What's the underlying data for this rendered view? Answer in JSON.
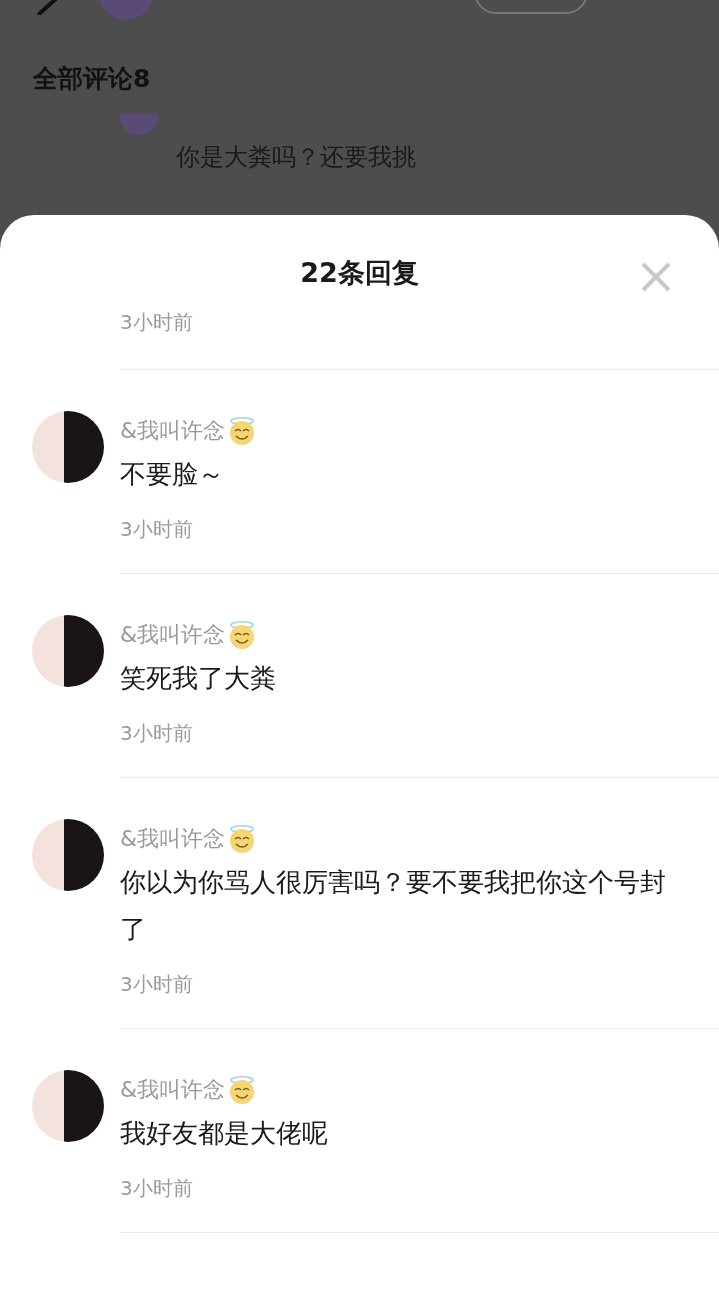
{
  "background": {
    "section_title": "全部评论8",
    "comment_text": "你是大粪吗？还要我挑"
  },
  "sheet": {
    "title": "22条回复",
    "partial_time": "3小时前",
    "replies": [
      {
        "user": "&我叫许念",
        "text": "不要脸～",
        "time": "3小时前"
      },
      {
        "user": "&我叫许念",
        "text": "笑死我了大粪",
        "time": "3小时前"
      },
      {
        "user": "&我叫许念",
        "text": "你以为你骂人很厉害吗？要不要我把你这个号封了",
        "time": "3小时前"
      },
      {
        "user": "&我叫许念",
        "text": "我好友都是大佬呢",
        "time": "3小时前"
      }
    ]
  }
}
